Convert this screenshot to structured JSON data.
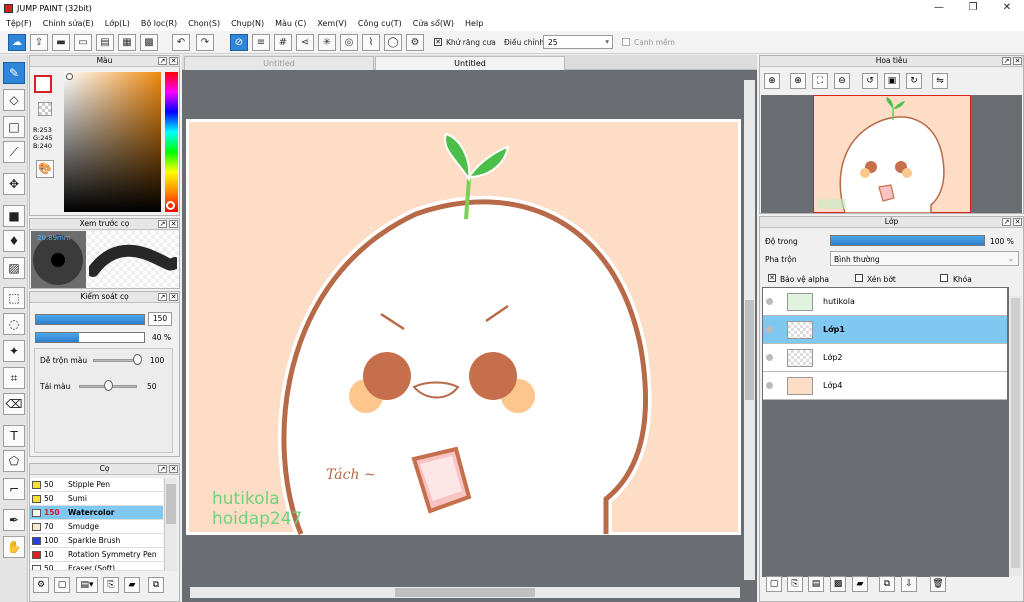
{
  "window": {
    "title": "JUMP PAINT (32bit)"
  },
  "menu": [
    "Tệp(F)",
    "Chỉnh sửa(E)",
    "Lớp(L)",
    "Bộ lọc(R)",
    "Chọn(S)",
    "Chụp(N)",
    "Màu (C)",
    "Xem(V)",
    "Công cụ(T)",
    "Cửa sổ(W)",
    "Help"
  ],
  "toolbar": {
    "antialias_label": "Khử răng cưa",
    "adjust_label": "Điều chỉnh",
    "adjust_value": "25",
    "edge_label": "Cạnh mềm"
  },
  "tabs": [
    "Untitled",
    "Untitled"
  ],
  "color_panel": {
    "title": "Màu",
    "r": "R:253",
    "g": "G:245",
    "b": "B:240"
  },
  "brush_preview": {
    "title": "Xem trước cọ",
    "size": "20.89mm"
  },
  "brush_control": {
    "title": "Kiểm soát cọ",
    "size_value": "150",
    "opacity_value": "40 %",
    "blend_label": "Dễ trộn màu",
    "blend_value": "100",
    "paint_label": "Tải màu",
    "paint_value": "50"
  },
  "brushes": {
    "title": "Cọ",
    "items": [
      {
        "size": "50",
        "name": "Stipple Pen",
        "color": "#f2e030"
      },
      {
        "size": "50",
        "name": "Sumi",
        "color": "#f2e030"
      },
      {
        "size": "150",
        "name": "Watercolor",
        "color": "#ffffff"
      },
      {
        "size": "70",
        "name": "Smudge",
        "color": "#f7e8c9"
      },
      {
        "size": "100",
        "name": "Sparkle Brush",
        "color": "#2a3fd8"
      },
      {
        "size": "10",
        "name": "Rotation Symmetry Pen",
        "color": "#e02020"
      },
      {
        "size": "50",
        "name": "Eraser (Soft)",
        "color": "#ffffff"
      }
    ]
  },
  "navigator": {
    "title": "Hoa tiêu"
  },
  "layers": {
    "title": "Lớp",
    "opacity_label": "Độ trong",
    "opacity_value": "100 %",
    "blend_label": "Pha trộn",
    "blend_value": "Bình thường",
    "protect_alpha": "Bảo vệ alpha",
    "clipping": "Xén bớt",
    "lock": "Khóa",
    "items": [
      {
        "name": "hutikola",
        "selected": false
      },
      {
        "name": "Lớp1",
        "selected": true
      },
      {
        "name": "Lớp2",
        "selected": false
      },
      {
        "name": "Lớp4",
        "selected": false
      }
    ]
  },
  "artwork": {
    "watermark_line1": "hutikola",
    "watermark_line2": "hoidap247",
    "sound_text": "Tách ~"
  },
  "colors": {
    "accent": "#2f86d8",
    "selected_row": "#7ec8f2",
    "canvas_bg": "#fdddc6",
    "outline": "#b86a48"
  }
}
